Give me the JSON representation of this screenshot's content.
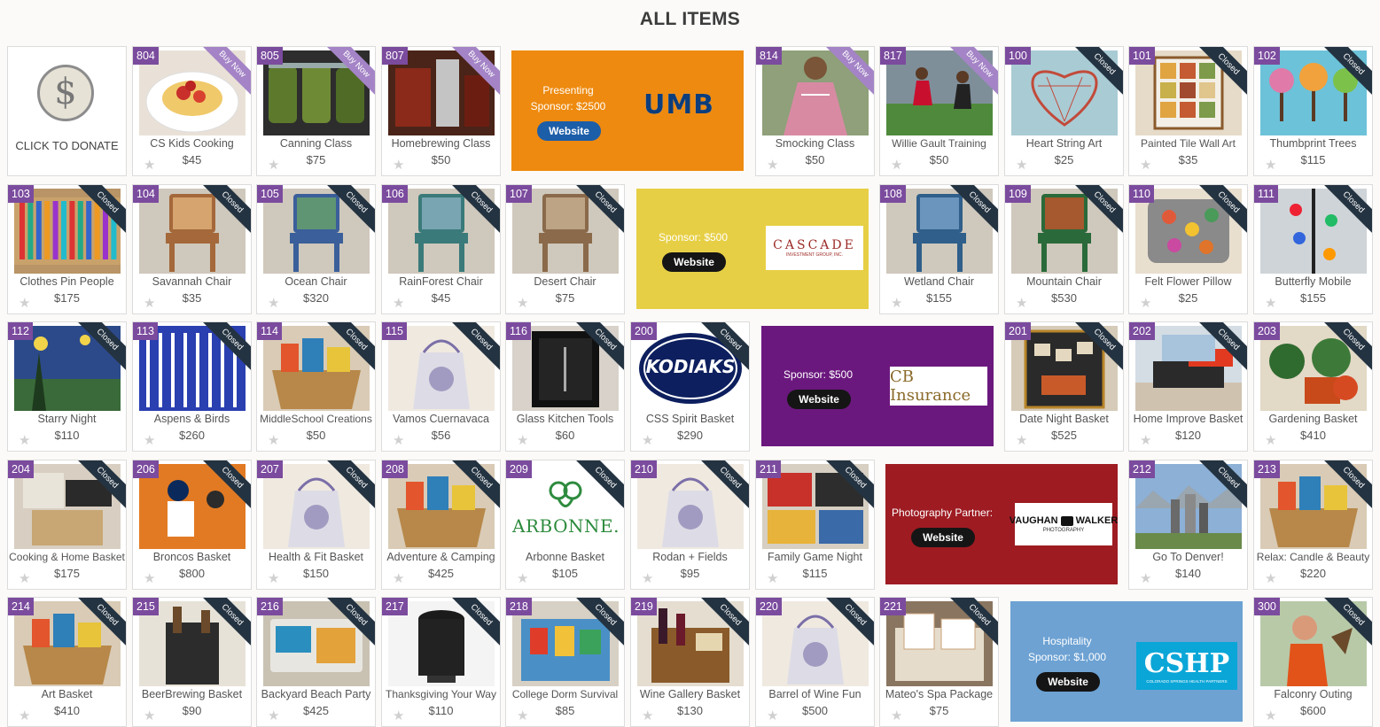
{
  "title": "ALL ITEMS",
  "donate": {
    "label": "CLICK TO DONATE",
    "icon": "dollar-icon"
  },
  "items": [
    {
      "num": "804",
      "name": "CS Kids Cooking",
      "price": "$45",
      "status": "Buy Now",
      "thumb": "pasta"
    },
    {
      "num": "805",
      "name": "Canning Class",
      "price": "$75",
      "status": "Buy Now",
      "thumb": "jars"
    },
    {
      "num": "807",
      "name": "Homebrewing Class",
      "price": "$50",
      "status": "Buy Now",
      "thumb": "brew"
    },
    {
      "num": "814",
      "name": "Smocking Class",
      "price": "$50",
      "status": "Buy Now",
      "thumb": "dress"
    },
    {
      "num": "817",
      "name": "Willie Gault Training",
      "price": "$50",
      "status": "Buy Now",
      "thumb": "track"
    },
    {
      "num": "100",
      "name": "Heart String Art",
      "price": "$25",
      "status": "Closed",
      "thumb": "heart"
    },
    {
      "num": "101",
      "name": "Painted Tile Wall Art",
      "price": "$35",
      "status": "Closed",
      "thumb": "tiles"
    },
    {
      "num": "102",
      "name": "Thumbprint Trees",
      "price": "$115",
      "status": "Closed",
      "thumb": "trees"
    },
    {
      "num": "103",
      "name": "Clothes Pin People",
      "price": "$175",
      "status": "Closed",
      "thumb": "pins"
    },
    {
      "num": "104",
      "name": "Savannah Chair",
      "price": "$35",
      "status": "Closed",
      "thumb": "chair"
    },
    {
      "num": "105",
      "name": "Ocean Chair",
      "price": "$320",
      "status": "Closed",
      "thumb": "chair"
    },
    {
      "num": "106",
      "name": "RainForest Chair",
      "price": "$45",
      "status": "Closed",
      "thumb": "chair"
    },
    {
      "num": "107",
      "name": "Desert Chair",
      "price": "$75",
      "status": "Closed",
      "thumb": "chair"
    },
    {
      "num": "108",
      "name": "Wetland Chair",
      "price": "$155",
      "status": "Closed",
      "thumb": "chair"
    },
    {
      "num": "109",
      "name": "Mountain Chair",
      "price": "$530",
      "status": "Closed",
      "thumb": "chair"
    },
    {
      "num": "110",
      "name": "Felt Flower Pillow",
      "price": "$25",
      "status": "Closed",
      "thumb": "pillow"
    },
    {
      "num": "111",
      "name": "Butterfly Mobile",
      "price": "$155",
      "status": "Closed",
      "thumb": "mobile"
    },
    {
      "num": "112",
      "name": "Starry Night",
      "price": "$110",
      "status": "Closed",
      "thumb": "starry"
    },
    {
      "num": "113",
      "name": "Aspens & Birds",
      "price": "$260",
      "status": "Closed",
      "thumb": "aspens"
    },
    {
      "num": "114",
      "name": "MiddleSchool Creations",
      "price": "$50",
      "status": "Closed",
      "thumb": "basket"
    },
    {
      "num": "115",
      "name": "Vamos Cuernavaca",
      "price": "$56",
      "status": "Closed",
      "thumb": "gift"
    },
    {
      "num": "116",
      "name": "Glass Kitchen Tools",
      "price": "$60",
      "status": "Closed",
      "thumb": "frame"
    },
    {
      "num": "200",
      "name": "CSS Spirit Basket",
      "price": "$290",
      "status": "Closed",
      "thumb": "kodiaks",
      "logo": "KODIAKS"
    },
    {
      "num": "201",
      "name": "Date Night Basket",
      "price": "$525",
      "status": "Closed",
      "thumb": "board"
    },
    {
      "num": "202",
      "name": "Home Improve Basket",
      "price": "$120",
      "status": "Closed",
      "thumb": "tools"
    },
    {
      "num": "203",
      "name": "Gardening Basket",
      "price": "$410",
      "status": "Closed",
      "thumb": "garden"
    },
    {
      "num": "204",
      "name": "Cooking & Home Basket",
      "price": "$175",
      "status": "Closed",
      "thumb": "boxes"
    },
    {
      "num": "206",
      "name": "Broncos Basket",
      "price": "$800",
      "status": "Closed",
      "thumb": "football"
    },
    {
      "num": "207",
      "name": "Health & Fit Basket",
      "price": "$150",
      "status": "Closed",
      "thumb": "gift"
    },
    {
      "num": "208",
      "name": "Adventure & Camping",
      "price": "$425",
      "status": "Closed",
      "thumb": "basket"
    },
    {
      "num": "209",
      "name": "Arbonne Basket",
      "price": "$105",
      "status": "Closed",
      "thumb": "arbonne",
      "logo": "ARBONNE."
    },
    {
      "num": "210",
      "name": "Rodan + Fields",
      "price": "$95",
      "status": "Closed",
      "thumb": "gift"
    },
    {
      "num": "211",
      "name": "Family Game Night",
      "price": "$115",
      "status": "Closed",
      "thumb": "games"
    },
    {
      "num": "212",
      "name": "Go To Denver!",
      "price": "$140",
      "status": "Closed",
      "thumb": "denver"
    },
    {
      "num": "213",
      "name": "Relax: Candle & Beauty",
      "price": "$220",
      "status": "Closed",
      "thumb": "basket"
    },
    {
      "num": "214",
      "name": "Art Basket",
      "price": "$410",
      "status": "Closed",
      "thumb": "basket"
    },
    {
      "num": "215",
      "name": "BeerBrewing Basket",
      "price": "$90",
      "status": "Closed",
      "thumb": "bag"
    },
    {
      "num": "216",
      "name": "Backyard Beach Party",
      "price": "$425",
      "status": "Closed",
      "thumb": "beach"
    },
    {
      "num": "217",
      "name": "Thanksgiving Your Way",
      "price": "$110",
      "status": "Closed",
      "thumb": "fryer"
    },
    {
      "num": "218",
      "name": "College Dorm Survival",
      "price": "$85",
      "status": "Closed",
      "thumb": "dorm"
    },
    {
      "num": "219",
      "name": "Wine Gallery Basket",
      "price": "$130",
      "status": "Closed",
      "thumb": "wine"
    },
    {
      "num": "220",
      "name": "Barrel of Wine Fun",
      "price": "$500",
      "status": "Closed",
      "thumb": "gift"
    },
    {
      "num": "221",
      "name": "Mateo's Spa Package",
      "price": "$75",
      "status": "Closed",
      "thumb": "spa"
    },
    {
      "num": "300",
      "name": "Falconry Outing",
      "price": "$600",
      "status": "Closed",
      "thumb": "falcon"
    }
  ],
  "sponsors": [
    {
      "lines": [
        "Presenting",
        "Sponsor: $2500"
      ],
      "button": "Website",
      "bg": "#ee8a0f",
      "btn_bg": "#1d5ea8",
      "logo": "UMB",
      "logo_style": "umb"
    },
    {
      "lines": [
        "Sponsor: $500"
      ],
      "button": "Website",
      "bg": "#e7cf45",
      "btn_bg": "#151515",
      "logo": "CASCADE",
      "logo_sub": "INVESTMENT GROUP, INC.",
      "logo_style": "cascade"
    },
    {
      "lines": [
        "Sponsor: $500"
      ],
      "button": "Website",
      "bg": "#6b187e",
      "btn_bg": "#151515",
      "logo": "CB Insurance",
      "logo_style": "cb"
    },
    {
      "lines": [
        "Photography Partner:"
      ],
      "button": "Website",
      "bg": "#9e1b22",
      "btn_bg": "#151515",
      "logo": "VAUGHAN",
      "logo_b": "WALKER",
      "logo_sub": "PHOTOGRAPHY",
      "logo_style": "vw"
    },
    {
      "lines": [
        "Hospitality",
        "Sponsor: $1,000"
      ],
      "button": "Website",
      "bg": "#6da2d3",
      "btn_bg": "#151515",
      "logo": "CSHP",
      "logo_sub": "COLORADO SPRINGS HEALTH PARTNERS",
      "logo_style": "cshp"
    }
  ],
  "colors": {
    "badge": "#7b4b9e",
    "ribbon_closed": "#243341",
    "ribbon_buy": "#a484c6",
    "star": "#d0d0d0"
  }
}
